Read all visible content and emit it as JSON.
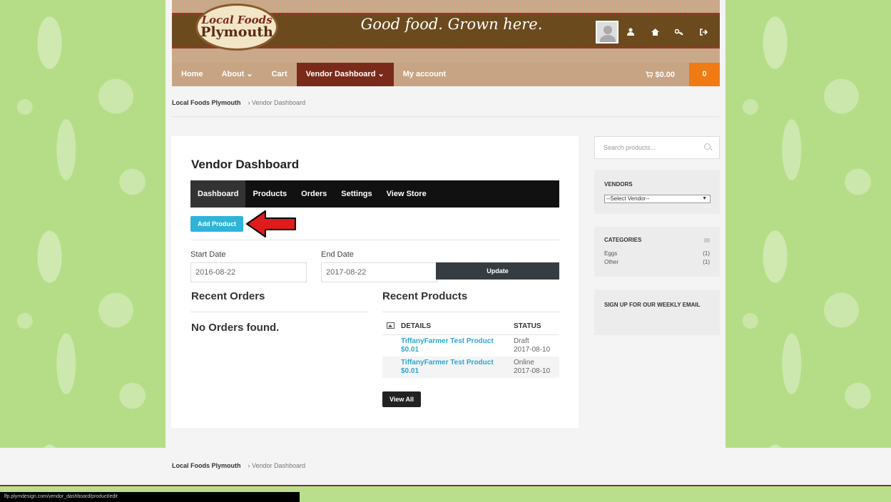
{
  "header": {
    "logo_line1": "Local Foods",
    "logo_line2": "Plymouth",
    "tagline": "Good food. Grown here.",
    "icons": [
      "user-icon",
      "home-icon",
      "key-icon",
      "logout-icon"
    ]
  },
  "nav": {
    "items": [
      {
        "label": "Home"
      },
      {
        "label": "About ⌄"
      },
      {
        "label": "Cart"
      },
      {
        "label": "Vendor Dashboard ⌄"
      },
      {
        "label": "My account"
      }
    ],
    "cart_total": "$0.00",
    "cart_count": "0"
  },
  "breadcrumb": {
    "home": "Local Foods Plymouth",
    "current": "› Vendor Dashboard"
  },
  "dashboard": {
    "title": "Vendor Dashboard",
    "tabs": [
      {
        "label": "Dashboard"
      },
      {
        "label": "Products"
      },
      {
        "label": "Orders"
      },
      {
        "label": "Settings"
      },
      {
        "label": "View Store"
      }
    ],
    "add_product": "Add Product",
    "start_label": "Start Date",
    "end_label": "End Date",
    "start_value": "2016-08-22",
    "end_value": "2017-08-22",
    "update": "Update",
    "recent_orders_title": "Recent Orders",
    "no_orders": "No Orders found.",
    "recent_products_title": "Recent Products",
    "products_columns": {
      "details": "DETAILS",
      "status": "STATUS"
    },
    "products": [
      {
        "name": "TiffanyFarmer Test Product",
        "price": "$0.01",
        "status": "Draft",
        "date": "2017-08-10"
      },
      {
        "name": "TiffanyFarmer Test Product",
        "price": "$0.01",
        "status": "Online",
        "date": "2017-08-10"
      }
    ],
    "view_all": "View All"
  },
  "sidebar": {
    "search_placeholder": "Search products...",
    "vendors_title": "VENDORS",
    "vendor_select": "--Select Vendor--",
    "categories_title": "CATEGORIES",
    "categories": [
      {
        "name": "Eggs",
        "count": "(1)"
      },
      {
        "name": "Other",
        "count": "(1)"
      }
    ],
    "signup_title": "SIGN UP FOR OUR WEEKLY EMAIL"
  },
  "footer": {
    "home": "Local Foods Plymouth",
    "current": "› Vendor Dashboard"
  },
  "status_bar": {
    "url": "lfp.plymdesign.com/vendor_dashboard/product/edit"
  },
  "colors": {
    "accent_blue": "#2fb4d8",
    "nav_active": "#7a2a1a",
    "cart_orange": "#f07a13",
    "arrow_red": "#e01b1b"
  }
}
